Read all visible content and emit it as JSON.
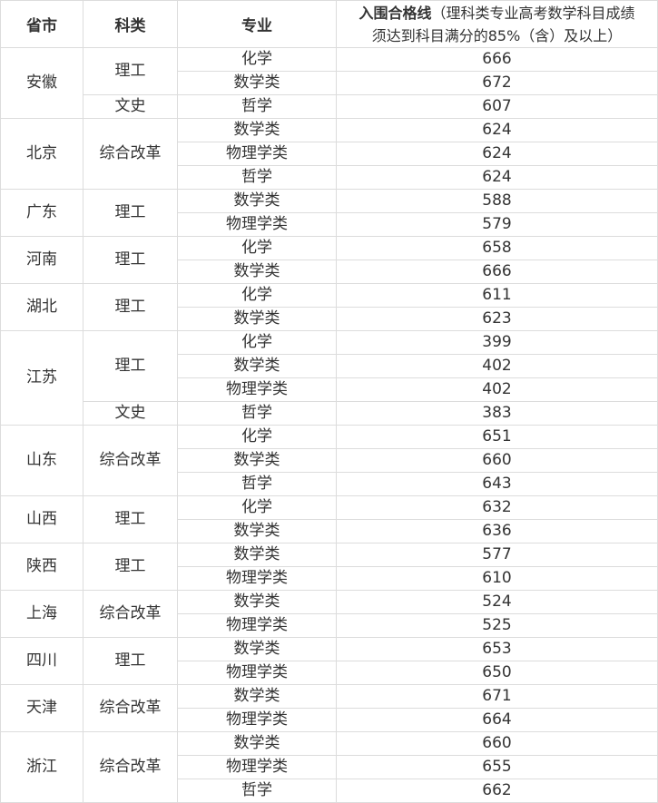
{
  "table": {
    "headers": {
      "province": "省市",
      "category": "科类",
      "major": "专业",
      "score_bold": "入围合格线",
      "score_note_line1": "（理科类专业高考数学科目成绩",
      "score_note_line2": "须达到科目满分的85%（含）及以上）"
    },
    "groups": [
      {
        "province": "安徽",
        "categories": [
          {
            "name": "理工",
            "rows": [
              {
                "major": "化学",
                "score": "666"
              },
              {
                "major": "数学类",
                "score": "672"
              }
            ]
          },
          {
            "name": "文史",
            "rows": [
              {
                "major": "哲学",
                "score": "607"
              }
            ]
          }
        ]
      },
      {
        "province": "北京",
        "categories": [
          {
            "name": "综合改革",
            "rows": [
              {
                "major": "数学类",
                "score": "624"
              },
              {
                "major": "物理学类",
                "score": "624"
              },
              {
                "major": "哲学",
                "score": "624"
              }
            ]
          }
        ]
      },
      {
        "province": "广东",
        "categories": [
          {
            "name": "理工",
            "rows": [
              {
                "major": "数学类",
                "score": "588"
              },
              {
                "major": "物理学类",
                "score": "579"
              }
            ]
          }
        ]
      },
      {
        "province": "河南",
        "categories": [
          {
            "name": "理工",
            "rows": [
              {
                "major": "化学",
                "score": "658"
              },
              {
                "major": "数学类",
                "score": "666"
              }
            ]
          }
        ]
      },
      {
        "province": "湖北",
        "categories": [
          {
            "name": "理工",
            "rows": [
              {
                "major": "化学",
                "score": "611"
              },
              {
                "major": "数学类",
                "score": "623"
              }
            ]
          }
        ]
      },
      {
        "province": "江苏",
        "categories": [
          {
            "name": "理工",
            "rows": [
              {
                "major": "化学",
                "score": "399"
              },
              {
                "major": "数学类",
                "score": "402"
              },
              {
                "major": "物理学类",
                "score": "402"
              }
            ]
          },
          {
            "name": "文史",
            "rows": [
              {
                "major": "哲学",
                "score": "383"
              }
            ]
          }
        ]
      },
      {
        "province": "山东",
        "categories": [
          {
            "name": "综合改革",
            "rows": [
              {
                "major": "化学",
                "score": "651"
              },
              {
                "major": "数学类",
                "score": "660"
              },
              {
                "major": "哲学",
                "score": "643"
              }
            ]
          }
        ]
      },
      {
        "province": "山西",
        "categories": [
          {
            "name": "理工",
            "rows": [
              {
                "major": "化学",
                "score": "632"
              },
              {
                "major": "数学类",
                "score": "636"
              }
            ]
          }
        ]
      },
      {
        "province": "陕西",
        "categories": [
          {
            "name": "理工",
            "rows": [
              {
                "major": "数学类",
                "score": "577"
              },
              {
                "major": "物理学类",
                "score": "610"
              }
            ]
          }
        ]
      },
      {
        "province": "上海",
        "categories": [
          {
            "name": "综合改革",
            "rows": [
              {
                "major": "数学类",
                "score": "524"
              },
              {
                "major": "物理学类",
                "score": "525"
              }
            ]
          }
        ]
      },
      {
        "province": "四川",
        "categories": [
          {
            "name": "理工",
            "rows": [
              {
                "major": "数学类",
                "score": "653"
              },
              {
                "major": "物理学类",
                "score": "650"
              }
            ]
          }
        ]
      },
      {
        "province": "天津",
        "categories": [
          {
            "name": "综合改革",
            "rows": [
              {
                "major": "数学类",
                "score": "671"
              },
              {
                "major": "物理学类",
                "score": "664"
              }
            ]
          }
        ]
      },
      {
        "province": "浙江",
        "categories": [
          {
            "name": "综合改革",
            "rows": [
              {
                "major": "数学类",
                "score": "660"
              },
              {
                "major": "物理学类",
                "score": "655"
              },
              {
                "major": "哲学",
                "score": "662"
              }
            ]
          }
        ]
      }
    ]
  }
}
